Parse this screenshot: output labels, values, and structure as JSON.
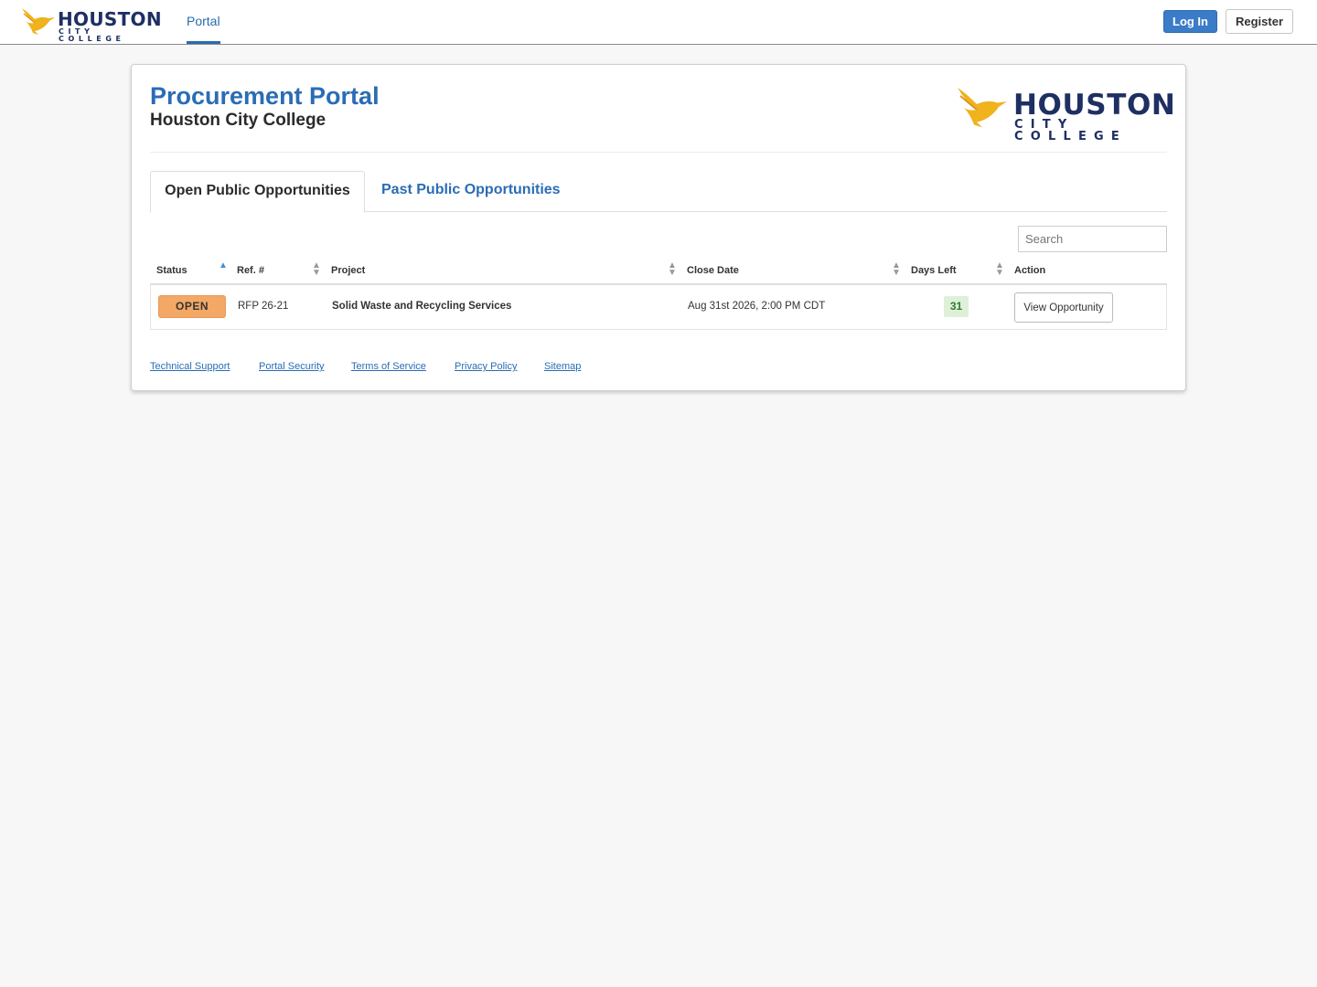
{
  "nav": {
    "logo_text": "HOUSTON",
    "logo_subtext": "CITY COLLEGE",
    "portal_link": "Portal",
    "login_button": "Log In",
    "register_button": "Register"
  },
  "header": {
    "title": "Procurement Portal",
    "subtitle": "Houston City College",
    "logo_text": "HOUSTON",
    "logo_subtext": "CITY COLLEGE"
  },
  "tabs": [
    {
      "label": "Open Public Opportunities",
      "active": true
    },
    {
      "label": "Past Public Opportunities",
      "active": false
    }
  ],
  "search": {
    "placeholder": "Search",
    "value": ""
  },
  "table": {
    "columns": [
      "Status",
      "Ref. #",
      "Project",
      "Close Date",
      "Days Left",
      "Action"
    ],
    "sorted_column": "Status",
    "sort_direction": "ascending",
    "rows": [
      {
        "status": "OPEN",
        "ref": "RFP 26-21",
        "project": "Solid Waste and Recycling Services",
        "close_date": "Aug 31st 2026, 2:00 PM CDT",
        "days_left": "31",
        "action": "View Opportunity"
      }
    ]
  },
  "footer": {
    "links": [
      "Technical Support",
      "Portal Security",
      "Terms of Service",
      "Privacy Policy",
      "Sitemap"
    ]
  },
  "colors": {
    "brand_blue": "#2a6db5",
    "logo_navy": "#1e2f63",
    "logo_gold": "#f0b21d",
    "status_open": "#f3a865",
    "days_left_bg": "#dff0d8"
  },
  "icons": {
    "logo": "bird-logo-icon",
    "sort_active": "sort-ascending-icon",
    "sort": "sort-both-icon"
  }
}
